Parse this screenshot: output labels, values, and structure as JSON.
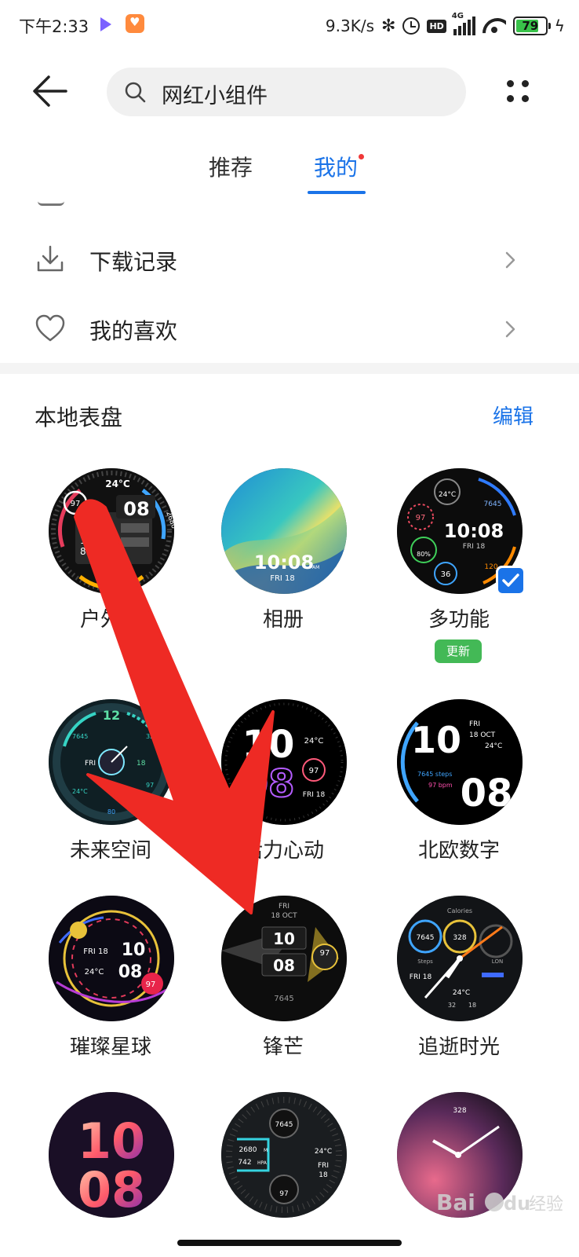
{
  "status_bar": {
    "time": "下午2:33",
    "net_speed": "9.3K/s",
    "network": "4G",
    "battery_level": "79",
    "battery_fraction": 0.79,
    "icons": [
      "video-app-icon",
      "health-app-icon",
      "bluetooth-icon",
      "alarm-icon",
      "hd-icon",
      "signal-icon",
      "wifi-icon",
      "battery-icon",
      "charging-icon"
    ]
  },
  "header": {
    "search_text": "网红小组件",
    "icons": [
      "back-arrow-icon",
      "search-icon",
      "more-grid-icon"
    ]
  },
  "tabs": [
    {
      "label": "推荐",
      "active": false
    },
    {
      "label": "我的",
      "active": true,
      "has_dot": true
    }
  ],
  "menu": [
    {
      "label": "下载记录",
      "icon": "download-icon"
    },
    {
      "label": "我的喜欢",
      "icon": "heart-icon"
    }
  ],
  "section": {
    "title": "本地表盘",
    "edit_label": "编辑"
  },
  "faces": [
    {
      "label": "户外探",
      "ring": "97",
      "line1": "24°C",
      "line2": "08",
      "line3": "FRI",
      "line4": "18",
      "line5": "85%",
      "line6": "2680"
    },
    {
      "label": "相册",
      "line1": "10:08",
      "line2": "AM",
      "line3": "FRI 18"
    },
    {
      "label": "多功能",
      "selected": true,
      "badge": "更新",
      "line1": "10:08",
      "line2": "FRI 18",
      "line3": "24°C",
      "line4": "7645",
      "line5": "97",
      "line6": "80%",
      "line7": "36",
      "line8": "120"
    },
    {
      "label": "未来空间",
      "line1": "12",
      "line2": "7645",
      "line3": "328",
      "line4": "FRI",
      "line5": "18",
      "line6": "24°C",
      "line7": "97",
      "line8": "80"
    },
    {
      "label": "活力心动",
      "line1": "10",
      "line2": "08",
      "line3": "24°C",
      "line4": "97",
      "line5": "FRI 18"
    },
    {
      "label": "北欧数字",
      "line1": "10",
      "line2": "FRI",
      "line3": "18 OCT",
      "line4": "24°C",
      "line5": "7645 steps",
      "line6": "97 bpm",
      "line7": "08"
    },
    {
      "label": "璀璨星球",
      "line1": "FRI 18",
      "line2": "10",
      "line3": "24°C",
      "line4": "08",
      "line5": "97"
    },
    {
      "label": "锋芒",
      "line1": "FRI",
      "line2": "18 OCT",
      "line3": "10",
      "line4": "08",
      "line5": "97",
      "line6": "7645"
    },
    {
      "label": "追逝时光",
      "line1": "Calories",
      "line2": "7645",
      "line3": "328",
      "line4": "Steps",
      "line5": "LON",
      "line6": "FRI 18",
      "line7": "24°C",
      "line8": "32",
      "line9": "18"
    },
    {
      "label": "",
      "line1": "10",
      "line2": "08"
    },
    {
      "label": "",
      "line1": "7645",
      "line2": "2680",
      "line3": "742",
      "line4": "24°C",
      "line5": "FRI",
      "line6": "18",
      "line7": "97",
      "line8": "M",
      "line9": "HPA"
    },
    {
      "label": "",
      "line1": "328"
    }
  ],
  "watermark": {
    "brand": "Bai",
    "brand2": "du",
    "suffix": "经验"
  },
  "colors": {
    "accent": "#1a73e8",
    "arrow": "#ee2a24",
    "update_green": "#43b956",
    "battery_green": "#39c24a"
  }
}
